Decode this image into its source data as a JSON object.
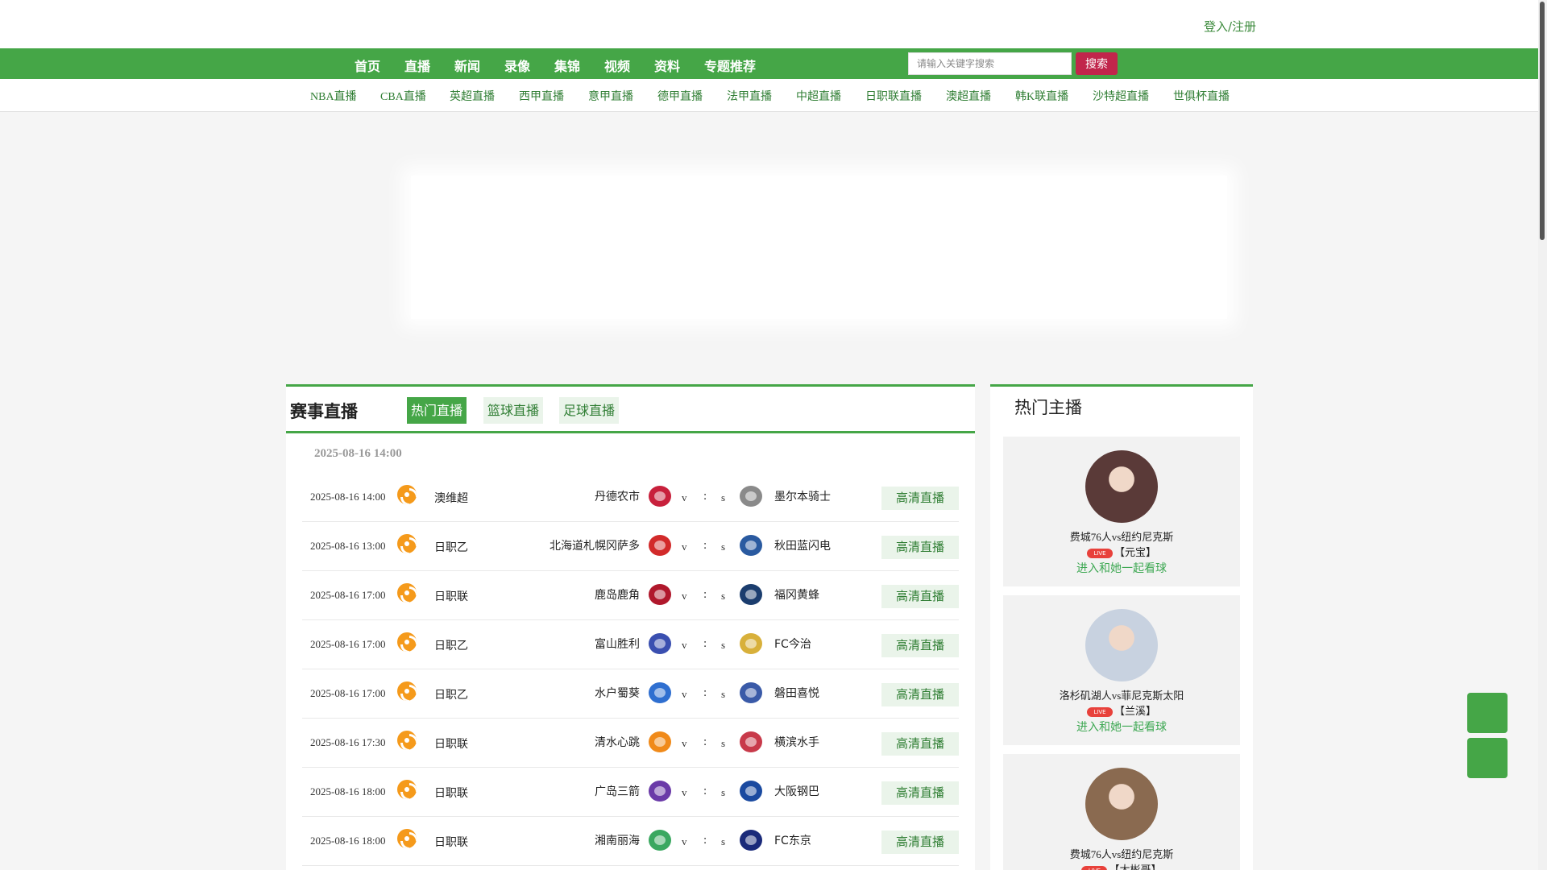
{
  "header": {
    "login_label": "登入/注册"
  },
  "nav": {
    "items": [
      "首页",
      "直播",
      "新闻",
      "录像",
      "集锦",
      "视频",
      "资料",
      "专题推荐"
    ],
    "search_placeholder": "请输入关键字搜索",
    "search_button": "搜索"
  },
  "subnav": {
    "items": [
      "NBA直播",
      "CBA直播",
      "英超直播",
      "西甲直播",
      "意甲直播",
      "德甲直播",
      "法甲直播",
      "中超直播",
      "日职联直播",
      "澳超直播",
      "韩K联直播",
      "沙特超直播",
      "世俱杯直播"
    ]
  },
  "matches_panel": {
    "title": "赛事直播",
    "tabs": [
      "热门直播",
      "篮球直播",
      "足球直播"
    ],
    "date_heading": "2025-08-16 14:00",
    "vs_left": "v",
    "vs_mid": ":",
    "vs_right": "s",
    "button_label": "高清直播",
    "matches": [
      {
        "time": "2025-08-16 14:00",
        "league": "澳维超",
        "home": "丹德农市",
        "away": "墨尔本骑士",
        "home_color": "#c8203c",
        "away_color": "#8a8a8a"
      },
      {
        "time": "2025-08-16 13:00",
        "league": "日职乙",
        "home": "北海道札幌冈萨多",
        "away": "秋田蓝闪电",
        "home_color": "#d22a2a",
        "away_color": "#2a5aa0"
      },
      {
        "time": "2025-08-16 17:00",
        "league": "日职联",
        "home": "鹿岛鹿角",
        "away": "福冈黄蜂",
        "home_color": "#b0182c",
        "away_color": "#1b3d6e"
      },
      {
        "time": "2025-08-16 17:00",
        "league": "日职乙",
        "home": "富山胜利",
        "away": "FC今治",
        "home_color": "#3a4fb0",
        "away_color": "#d8b03a"
      },
      {
        "time": "2025-08-16 17:00",
        "league": "日职乙",
        "home": "水户蜀葵",
        "away": "磐田喜悦",
        "home_color": "#2f6fd0",
        "away_color": "#3a5aa8"
      },
      {
        "time": "2025-08-16 17:30",
        "league": "日职联",
        "home": "清水心跳",
        "away": "横滨水手",
        "home_color": "#f08a1a",
        "away_color": "#c83a4a"
      },
      {
        "time": "2025-08-16 18:00",
        "league": "日职联",
        "home": "广岛三箭",
        "away": "大阪钢巴",
        "home_color": "#6a3aa8",
        "away_color": "#1a4aa0"
      },
      {
        "time": "2025-08-16 18:00",
        "league": "日职联",
        "home": "湘南丽海",
        "away": "FC东京",
        "home_color": "#3aa860",
        "away_color": "#1a2a7a"
      }
    ]
  },
  "anchors_panel": {
    "title": "热门主播",
    "live_badge": "LIVE",
    "cta_label": "进入和她一起看球",
    "anchors": [
      {
        "match": "费城76人vs纽约尼克斯",
        "name": "【元宝】",
        "avatar_color": "#5a3a38"
      },
      {
        "match": "洛杉矶湖人vs菲尼克斯太阳",
        "name": "【兰溪】",
        "avatar_color": "#c8d2e0"
      },
      {
        "match": "费城76人vs纽约尼克斯",
        "name": "【大彬哥】",
        "avatar_color": "#8a6a50"
      }
    ]
  }
}
